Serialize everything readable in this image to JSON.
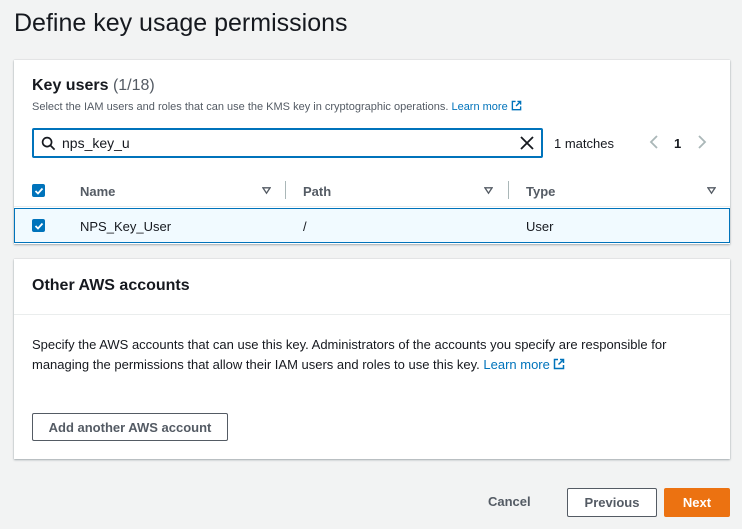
{
  "page": {
    "title": "Define key usage permissions"
  },
  "key_users": {
    "title": "Key users",
    "count": "(1/18)",
    "description": "Select the IAM users and roles that can use the KMS key in cryptographic operations.",
    "learn_more": "Learn more",
    "search": {
      "value": "nps_key_u",
      "placeholder": ""
    },
    "matches": "1 matches",
    "page_number": "1",
    "columns": [
      "Name",
      "Path",
      "Type"
    ],
    "rows": [
      {
        "name": "NPS_Key_User",
        "path": "/",
        "type": "User",
        "selected": true
      }
    ]
  },
  "other_accounts": {
    "title": "Other AWS accounts",
    "description": "Specify the AWS accounts that can use this key. Administrators of the accounts you specify are responsible for managing the permissions that allow their IAM users and roles to use this key.",
    "learn_more": "Learn more",
    "add_button": "Add another AWS account"
  },
  "footer": {
    "cancel": "Cancel",
    "previous": "Previous",
    "next": "Next"
  },
  "colors": {
    "accent": "#0073bb",
    "primary_button": "#ec7211",
    "background": "#f2f3f3"
  },
  "icons": [
    "search-icon",
    "clear-icon",
    "external-link-icon",
    "chevron-left-icon",
    "chevron-right-icon",
    "sort-caret-icon",
    "checkmark-icon"
  ]
}
